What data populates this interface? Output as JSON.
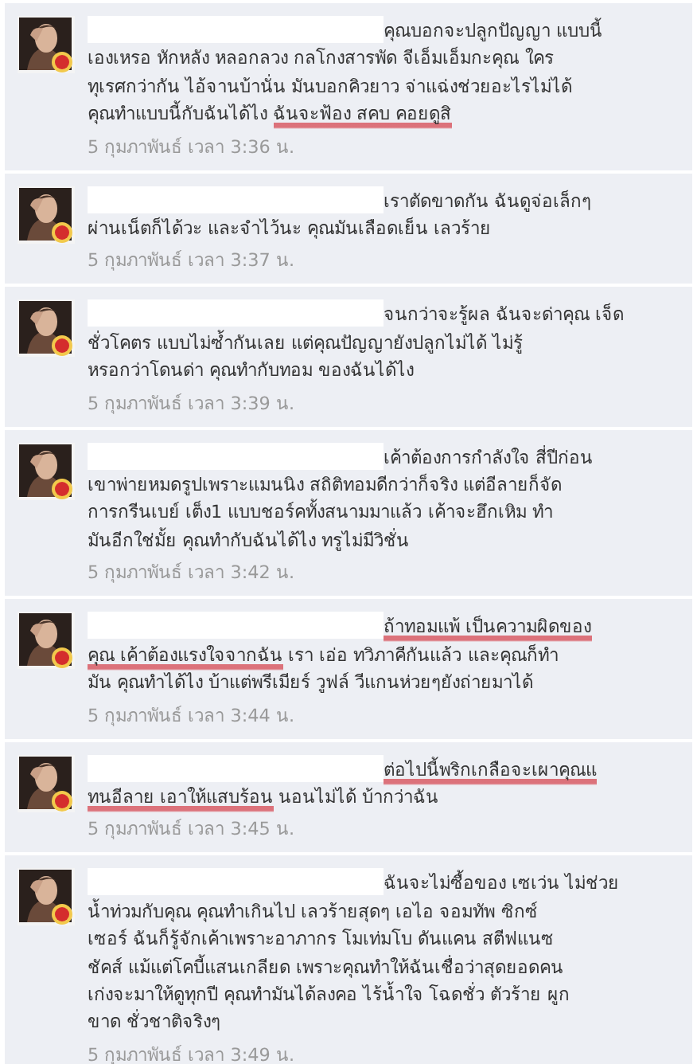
{
  "comments": [
    {
      "segments": [
        {
          "text": "คุณบอกจะปลูกปัญญา แบบนี้\nเองเหรอ หักหลัง หลอกลวง กลโกงสารพัด จีเอ็มเอ็มกะคุณ ใคร\nทุเรศกว่ากัน ไอ้จานบ้านั่น มันบอกคิวยาว จ่าแฉ่งช่วยอะไรไม่ได้\nคุณทำแบบนี้กับฉันได้ไง ",
          "underlined": false
        },
        {
          "text": "ฉันจะฟ้อง สคบ คอยดูสิ",
          "underlined": true
        }
      ],
      "time": "5 กุมภาพันธ์ เวลา 3:36 น."
    },
    {
      "segments": [
        {
          "text": "เราตัดขาดกัน ฉันดูจ่อเล็กๆ\nผ่านเน็ตก็ได้วะ และจำไว้นะ คุณมันเลือดเย็น เลวร้าย",
          "underlined": false
        }
      ],
      "time": "5 กุมภาพันธ์ เวลา 3:37 น."
    },
    {
      "segments": [
        {
          "text": "จนกว่าจะรู้ผล ฉันจะด่าคุณ เจ็ด\nชั่วโคตร แบบไม่ซ้ำกันเลย แต่คุณปัญญายังปลูกไม่ได้ ไม่รู้\nหรอกว่าโดนด่า คุณทำกับทอม ของฉันได้ไง",
          "underlined": false
        }
      ],
      "time": "5 กุมภาพันธ์ เวลา 3:39 น."
    },
    {
      "segments": [
        {
          "text": "เค้าต้องการกำลังใจ สี่ปีก่อน\nเขาพ่ายหมดรูปเพราะแมนนิง สถิติทอมดีกว่าก็จริง แต่อีลายก็จัด\nการกรีนเบย์ เต็ง1 แบบชอร์คทั้งสนามมาแล้ว เค้าจะฮึกเหิม ทำ\nมันอีกใช่มั้ย คุณทำกับฉันได้ไง ทรูไม่มีวิชั่น",
          "underlined": false
        }
      ],
      "time": "5 กุมภาพันธ์ เวลา 3:42 น."
    },
    {
      "segments": [
        {
          "text": "ถ้าทอมแพ้ เป็นความผิดของ\nคุณ เค้าต้องแรงใจจากฉัน",
          "underlined": true
        },
        {
          "text": " เรา เอ่อ ทวิภาคีกันแล้ว และคุณก็ทำ\nมัน คุณทำได้ไง บ้าแต่พรีเมียร์ วูฟล์ วีแกนห่วยๆยังถ่ายมาได้",
          "underlined": false
        }
      ],
      "time": "5 กุมภาพันธ์ เวลา 3:44 น."
    },
    {
      "segments": [
        {
          "text": "ต่อไปนี้พริกเกลือจะเผาคุณแ\nทนอีลาย เอาให้แสบร้อน",
          "underlined": true
        },
        {
          "text": " นอนไม่ได้ บ้ากว่าฉัน",
          "underlined": false
        }
      ],
      "time": "5 กุมภาพันธ์ เวลา 3:45 น."
    },
    {
      "segments": [
        {
          "text": "ฉันจะไม่ซื้อของ เซเว่น ไม่ช่วย\nน้ำท่วมกับคุณ คุณทำเกินไป เลวร้ายสุดๆ เอไอ จอมทัพ ซิกซ์\nเซอร์ ฉันก็รู้จักเค้าเพราะอาภากร โมเท่มโบ ดันแคน สตีฟแนซ\nชัคส์ แม้แต่โคบี้แสนเกลียด เพราะคุณทำให้ฉันเชื่อว่าสุดยอดคน\nเก่งจะมาให้ดูทุกปี คุณทำมันได้ลงคอ ไร้น้ำใจ โฉดชั่ว ตัวร้าย ผูก\nขาด ชั่วชาติจริงๆ",
          "underlined": false
        }
      ],
      "time": "5 กุมภาพันธ์ เวลา 3:49 น."
    }
  ]
}
